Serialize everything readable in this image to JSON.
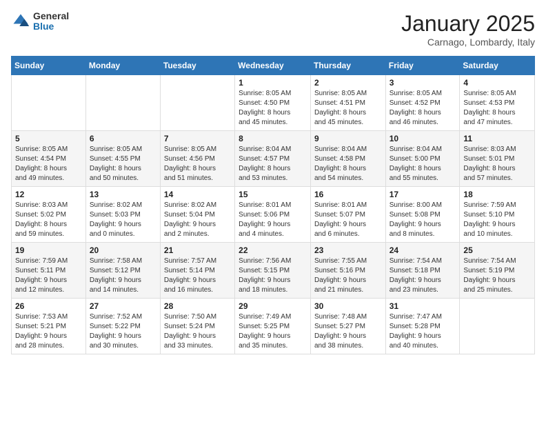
{
  "logo": {
    "general": "General",
    "blue": "Blue"
  },
  "title": "January 2025",
  "subtitle": "Carnago, Lombardy, Italy",
  "days_header": [
    "Sunday",
    "Monday",
    "Tuesday",
    "Wednesday",
    "Thursday",
    "Friday",
    "Saturday"
  ],
  "weeks": [
    [
      {
        "day": "",
        "info": ""
      },
      {
        "day": "",
        "info": ""
      },
      {
        "day": "",
        "info": ""
      },
      {
        "day": "1",
        "info": "Sunrise: 8:05 AM\nSunset: 4:50 PM\nDaylight: 8 hours\nand 45 minutes."
      },
      {
        "day": "2",
        "info": "Sunrise: 8:05 AM\nSunset: 4:51 PM\nDaylight: 8 hours\nand 45 minutes."
      },
      {
        "day": "3",
        "info": "Sunrise: 8:05 AM\nSunset: 4:52 PM\nDaylight: 8 hours\nand 46 minutes."
      },
      {
        "day": "4",
        "info": "Sunrise: 8:05 AM\nSunset: 4:53 PM\nDaylight: 8 hours\nand 47 minutes."
      }
    ],
    [
      {
        "day": "5",
        "info": "Sunrise: 8:05 AM\nSunset: 4:54 PM\nDaylight: 8 hours\nand 49 minutes."
      },
      {
        "day": "6",
        "info": "Sunrise: 8:05 AM\nSunset: 4:55 PM\nDaylight: 8 hours\nand 50 minutes."
      },
      {
        "day": "7",
        "info": "Sunrise: 8:05 AM\nSunset: 4:56 PM\nDaylight: 8 hours\nand 51 minutes."
      },
      {
        "day": "8",
        "info": "Sunrise: 8:04 AM\nSunset: 4:57 PM\nDaylight: 8 hours\nand 53 minutes."
      },
      {
        "day": "9",
        "info": "Sunrise: 8:04 AM\nSunset: 4:58 PM\nDaylight: 8 hours\nand 54 minutes."
      },
      {
        "day": "10",
        "info": "Sunrise: 8:04 AM\nSunset: 5:00 PM\nDaylight: 8 hours\nand 55 minutes."
      },
      {
        "day": "11",
        "info": "Sunrise: 8:03 AM\nSunset: 5:01 PM\nDaylight: 8 hours\nand 57 minutes."
      }
    ],
    [
      {
        "day": "12",
        "info": "Sunrise: 8:03 AM\nSunset: 5:02 PM\nDaylight: 8 hours\nand 59 minutes."
      },
      {
        "day": "13",
        "info": "Sunrise: 8:02 AM\nSunset: 5:03 PM\nDaylight: 9 hours\nand 0 minutes."
      },
      {
        "day": "14",
        "info": "Sunrise: 8:02 AM\nSunset: 5:04 PM\nDaylight: 9 hours\nand 2 minutes."
      },
      {
        "day": "15",
        "info": "Sunrise: 8:01 AM\nSunset: 5:06 PM\nDaylight: 9 hours\nand 4 minutes."
      },
      {
        "day": "16",
        "info": "Sunrise: 8:01 AM\nSunset: 5:07 PM\nDaylight: 9 hours\nand 6 minutes."
      },
      {
        "day": "17",
        "info": "Sunrise: 8:00 AM\nSunset: 5:08 PM\nDaylight: 9 hours\nand 8 minutes."
      },
      {
        "day": "18",
        "info": "Sunrise: 7:59 AM\nSunset: 5:10 PM\nDaylight: 9 hours\nand 10 minutes."
      }
    ],
    [
      {
        "day": "19",
        "info": "Sunrise: 7:59 AM\nSunset: 5:11 PM\nDaylight: 9 hours\nand 12 minutes."
      },
      {
        "day": "20",
        "info": "Sunrise: 7:58 AM\nSunset: 5:12 PM\nDaylight: 9 hours\nand 14 minutes."
      },
      {
        "day": "21",
        "info": "Sunrise: 7:57 AM\nSunset: 5:14 PM\nDaylight: 9 hours\nand 16 minutes."
      },
      {
        "day": "22",
        "info": "Sunrise: 7:56 AM\nSunset: 5:15 PM\nDaylight: 9 hours\nand 18 minutes."
      },
      {
        "day": "23",
        "info": "Sunrise: 7:55 AM\nSunset: 5:16 PM\nDaylight: 9 hours\nand 21 minutes."
      },
      {
        "day": "24",
        "info": "Sunrise: 7:54 AM\nSunset: 5:18 PM\nDaylight: 9 hours\nand 23 minutes."
      },
      {
        "day": "25",
        "info": "Sunrise: 7:54 AM\nSunset: 5:19 PM\nDaylight: 9 hours\nand 25 minutes."
      }
    ],
    [
      {
        "day": "26",
        "info": "Sunrise: 7:53 AM\nSunset: 5:21 PM\nDaylight: 9 hours\nand 28 minutes."
      },
      {
        "day": "27",
        "info": "Sunrise: 7:52 AM\nSunset: 5:22 PM\nDaylight: 9 hours\nand 30 minutes."
      },
      {
        "day": "28",
        "info": "Sunrise: 7:50 AM\nSunset: 5:24 PM\nDaylight: 9 hours\nand 33 minutes."
      },
      {
        "day": "29",
        "info": "Sunrise: 7:49 AM\nSunset: 5:25 PM\nDaylight: 9 hours\nand 35 minutes."
      },
      {
        "day": "30",
        "info": "Sunrise: 7:48 AM\nSunset: 5:27 PM\nDaylight: 9 hours\nand 38 minutes."
      },
      {
        "day": "31",
        "info": "Sunrise: 7:47 AM\nSunset: 5:28 PM\nDaylight: 9 hours\nand 40 minutes."
      },
      {
        "day": "",
        "info": ""
      }
    ]
  ]
}
